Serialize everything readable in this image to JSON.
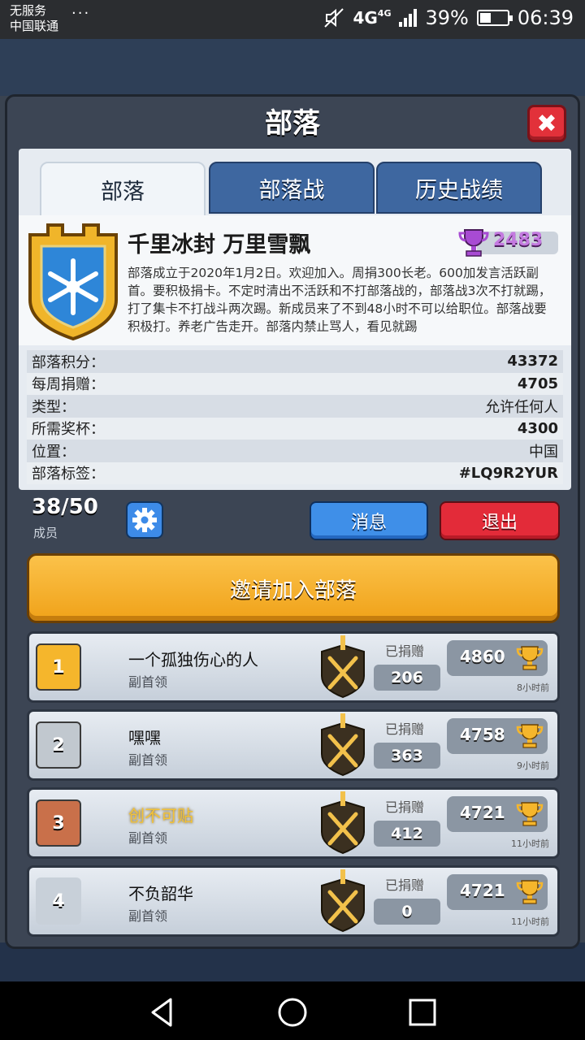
{
  "status_bar": {
    "carrier_line1": "无服务",
    "carrier_line2": "中国联通",
    "dots": "···",
    "network": "4G",
    "network_small": "4G",
    "battery": "39%",
    "time": "06:39"
  },
  "dialog": {
    "title": "部落",
    "close_label": "✖"
  },
  "tabs": [
    {
      "label": "部落",
      "active": true
    },
    {
      "label": "部落战",
      "active": false
    },
    {
      "label": "历史战绩",
      "active": false
    }
  ],
  "clan": {
    "name": "千里冰封 万里雪飘",
    "trophies": "2483",
    "description": "部落成立于2020年1月2日。欢迎加入。周捐300长老。600加发言活跃副首。要积极捐卡。不定时清出不活跃和不打部落战的，部落战3次不打就踢，打了集卡不打战斗两次踢。新成员来了不到48小时不可以给职位。部落战要积极打。养老广告走开。部落内禁止骂人，看见就踢"
  },
  "info": [
    {
      "label": "部落积分：",
      "value": "43372",
      "bold": true
    },
    {
      "label": "每周捐赠：",
      "value": "4705",
      "bold": true
    },
    {
      "label": "类型：",
      "value": "允许任何人",
      "bold": false
    },
    {
      "label": "所需奖杯：",
      "value": "4300",
      "bold": true
    },
    {
      "label": "位置：",
      "value": "中国",
      "bold": false
    },
    {
      "label": "部落标签：",
      "value": "#LQ9R2YUR",
      "bold": true
    }
  ],
  "members_bar": {
    "count": "38/50",
    "count_label": "成员",
    "message_button": "消息",
    "leave_button": "退出"
  },
  "invite_button": "邀请加入部落",
  "members": [
    {
      "rank": "1",
      "name": "一个孤独伤心的人",
      "role": "副首领",
      "donated_label": "已捐赠",
      "donated": "206",
      "trophies": "4860",
      "last_seen": "8小时前"
    },
    {
      "rank": "2",
      "name": "嘿嘿",
      "role": "副首领",
      "donated_label": "已捐赠",
      "donated": "363",
      "trophies": "4758",
      "last_seen": "9小时前"
    },
    {
      "rank": "3",
      "name": "创不可贴",
      "role": "副首领",
      "donated_label": "已捐赠",
      "donated": "412",
      "trophies": "4721",
      "last_seen": "11小时前"
    },
    {
      "rank": "4",
      "name": "不负韶华",
      "role": "副首领",
      "donated_label": "已捐赠",
      "donated": "0",
      "trophies": "4721",
      "last_seen": "11小时前"
    }
  ],
  "colors": {
    "gold": "#f5b62c",
    "silver": "#c1c8cf",
    "bronze": "#c9704a",
    "blue_button": "#3f8fe8",
    "red_button": "#e32b39",
    "invite": "#f6b230"
  }
}
